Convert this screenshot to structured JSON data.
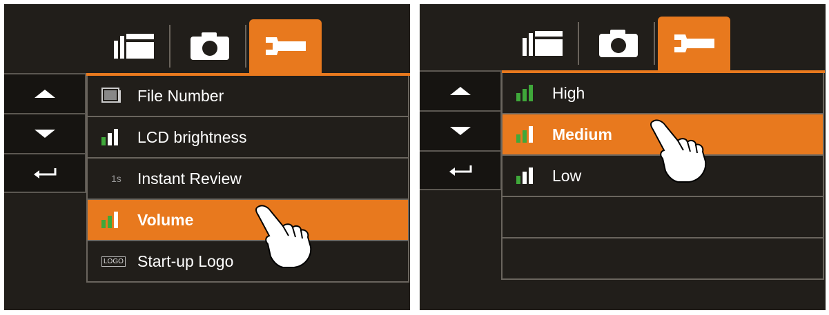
{
  "left_screen": {
    "tabs": [
      {
        "icon": "gallery-icon"
      },
      {
        "icon": "camera-icon"
      },
      {
        "icon": "wrench-icon",
        "active": true
      }
    ],
    "nav": [
      "up-arrow-icon",
      "down-arrow-icon",
      "return-icon"
    ],
    "menu": [
      {
        "icon": "file-number-icon",
        "label": "File Number"
      },
      {
        "icon": "brightness-bars-icon",
        "label": "LCD brightness"
      },
      {
        "icon": "instant-review-icon",
        "icon_text": "1s",
        "label": "Instant Review"
      },
      {
        "icon": "volume-bars-icon",
        "label": "Volume",
        "selected": true
      },
      {
        "icon": "logo-icon",
        "icon_text": "LOGO",
        "label": "Start-up Logo"
      }
    ]
  },
  "right_screen": {
    "tabs": [
      {
        "icon": "gallery-icon"
      },
      {
        "icon": "camera-icon"
      },
      {
        "icon": "wrench-icon",
        "active": true
      }
    ],
    "nav": [
      "up-arrow-icon",
      "down-arrow-icon",
      "return-icon"
    ],
    "options": [
      {
        "icon": "level-high-icon",
        "label": "High"
      },
      {
        "icon": "level-medium-icon",
        "label": "Medium",
        "selected": true
      },
      {
        "icon": "level-low-icon",
        "label": "Low"
      },
      {
        "label": ""
      },
      {
        "label": ""
      }
    ]
  },
  "colors": {
    "accent": "#e8791e",
    "panel": "#211e1a",
    "bar_green": "#3fa83a"
  }
}
